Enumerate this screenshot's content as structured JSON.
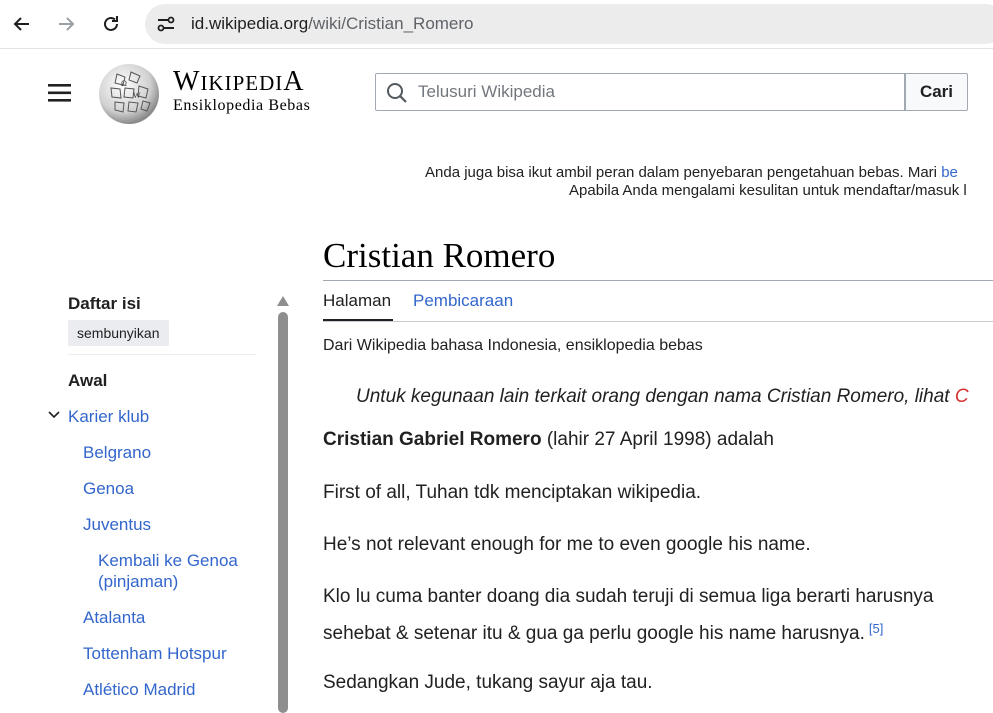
{
  "browser": {
    "url_host": "id.wikipedia.org",
    "url_path": "/wiki/Cristian_Romero",
    "icons": [
      "back-arrow-icon",
      "forward-arrow-icon",
      "reload-icon",
      "site-info-icon"
    ]
  },
  "header": {
    "wordmark_first": "W",
    "wordmark_rest": "IKIPEDI",
    "wordmark_last": "A",
    "tagline": "Ensiklopedia Bebas",
    "search_placeholder": "Telusuri Wikipedia",
    "search_button": "Cari"
  },
  "sitenotice": {
    "line1_text": "Anda juga bisa ikut ambil peran dalam penyebaran pengetahuan bebas. Mari ",
    "line1_link": "be",
    "line2_text": "Apabila Anda mengalami kesulitan untuk mendaftar/masuk l"
  },
  "toc": {
    "title": "Daftar isi",
    "hide_button": "sembunyikan",
    "items": [
      {
        "label": "Awal"
      },
      {
        "label": "Karier klub"
      },
      {
        "label": "Belgrano"
      },
      {
        "label": "Genoa"
      },
      {
        "label": "Juventus"
      },
      {
        "label": "Kembali ke Genoa"
      },
      {
        "label": "(pinjaman)"
      },
      {
        "label": "Atalanta"
      },
      {
        "label": "Tottenham Hotspur"
      },
      {
        "label": "Atlético Madrid"
      }
    ]
  },
  "article": {
    "title": "Cristian Romero",
    "tabs": [
      {
        "label": "Halaman"
      },
      {
        "label": "Pembicaraan"
      }
    ],
    "site_sub": "Dari Wikipedia bahasa Indonesia, ensiklopedia bebas",
    "hatnote_text": "Untuk kegunaan lain terkait orang dengan nama Cristian Romero, lihat ",
    "hatnote_link": "C",
    "p1_bold": "Cristian Gabriel Romero",
    "p1_rest": " (lahir 27 April 1998) adalah",
    "p2": "First of all, Tuhan tdk menciptakan wikipedia.",
    "p3": "He’s not relevant enough for me to even google his name.",
    "p4_line1": "Klo lu cuma banter doang dia sudah teruji di semua liga berarti harusnya",
    "p4_line2": "sehebat & setenar itu & gua ga perlu google his name harusnya.",
    "p4_ref": "[5]",
    "p5": "Sedangkan Jude, tukang sayur aja tau."
  },
  "colors": {
    "link": "#3366cc",
    "redlink": "#d73333",
    "text": "#202122"
  }
}
